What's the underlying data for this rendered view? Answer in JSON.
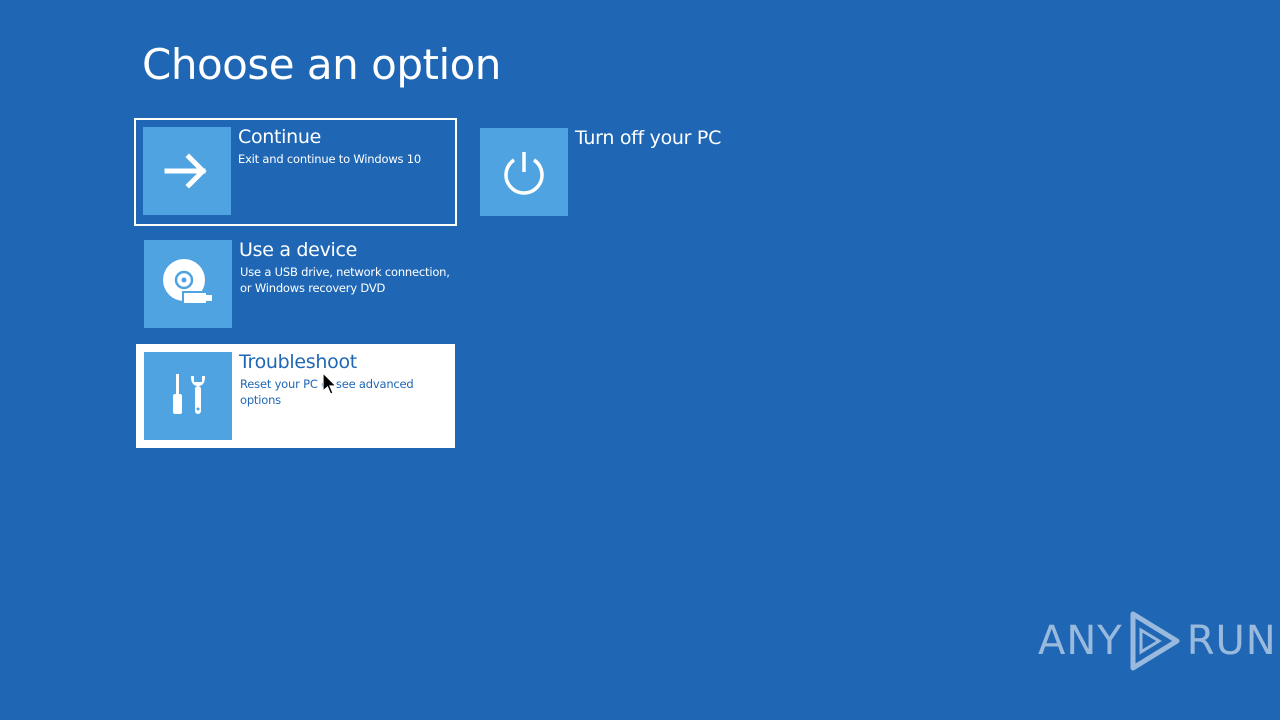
{
  "page": {
    "title": "Choose an option"
  },
  "options": [
    {
      "name": "Continue",
      "description": "Exit and continue to Windows 10",
      "icon": "arrow-right-icon"
    },
    {
      "name": "Use a device",
      "description": "Use a USB drive, network connection, or Windows recovery DVD",
      "icon": "disc-usb-icon"
    },
    {
      "name": "Troubleshoot",
      "description": "Reset your PC or see advanced options",
      "icon": "tools-icon"
    },
    {
      "name": "Turn off your PC",
      "description": "",
      "icon": "power-icon"
    }
  ],
  "watermark": {
    "left": "ANY",
    "right": "RUN"
  },
  "colors": {
    "background": "#1f67b5",
    "tile_icon": "#4fa3e0",
    "text": "#ffffff"
  }
}
